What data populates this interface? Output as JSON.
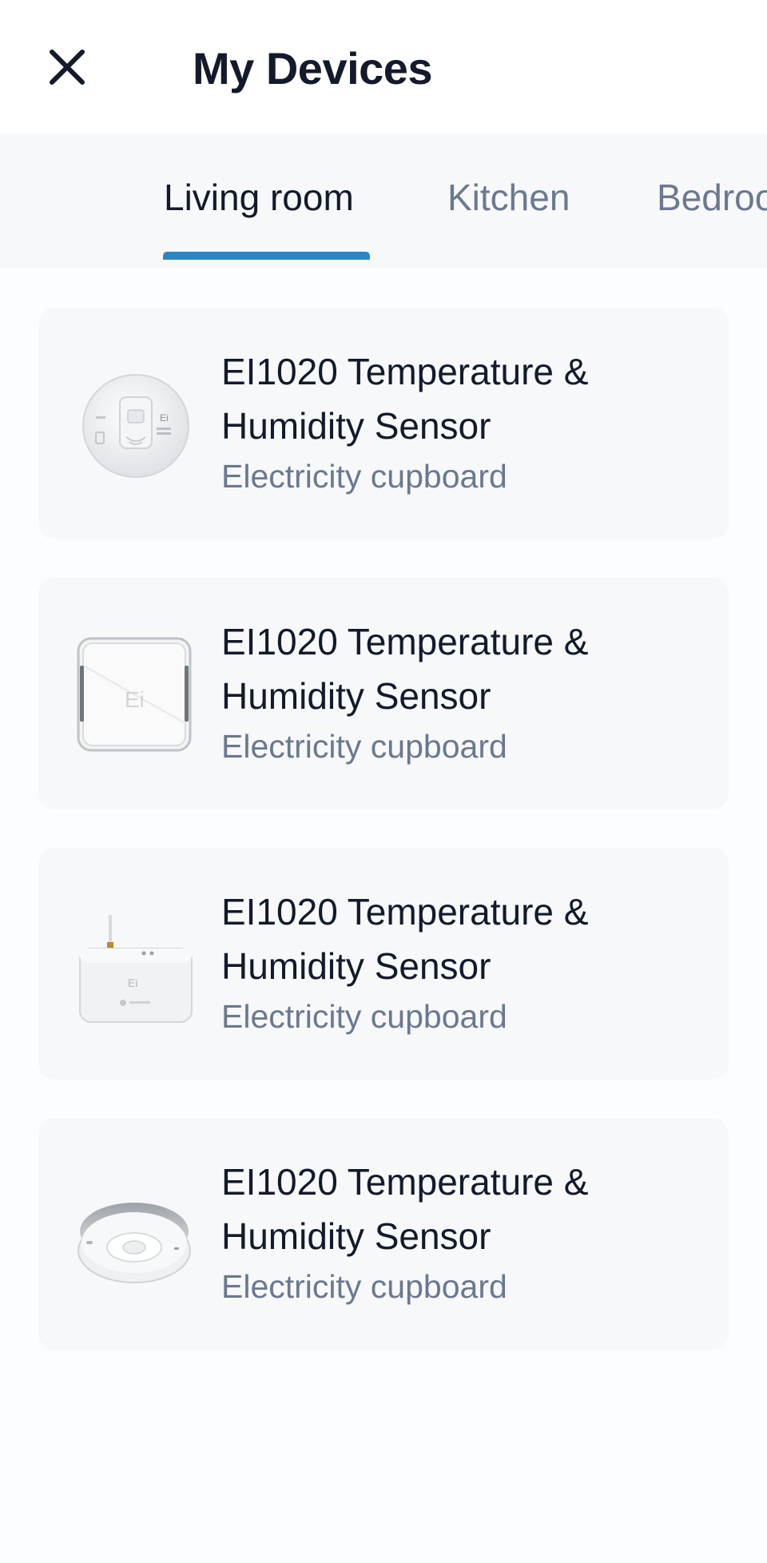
{
  "header": {
    "title": "My Devices",
    "close_icon": "close-icon"
  },
  "tabs": [
    {
      "label": "Living room",
      "active": true
    },
    {
      "label": "Kitchen",
      "active": false
    },
    {
      "label": "Bedroom",
      "active": false
    }
  ],
  "colors": {
    "accent": "#2b86c5",
    "text_primary": "#121a2b",
    "text_secondary": "#6a7890",
    "card_bg": "#f6f8fa"
  },
  "devices": [
    {
      "name": "EI1020 Temperature & Humidity Sensor",
      "location": "Electricity cupboard",
      "image": "co-alarm-device-image"
    },
    {
      "name": "EI1020 Temperature & Humidity Sensor",
      "location": "Electricity cupboard",
      "image": "square-sensor-device-image"
    },
    {
      "name": "EI1020 Temperature & Humidity Sensor",
      "location": "Electricity cupboard",
      "image": "gateway-hub-device-image"
    },
    {
      "name": "EI1020 Temperature & Humidity Sensor",
      "location": "Electricity cupboard",
      "image": "smoke-alarm-device-image"
    }
  ]
}
